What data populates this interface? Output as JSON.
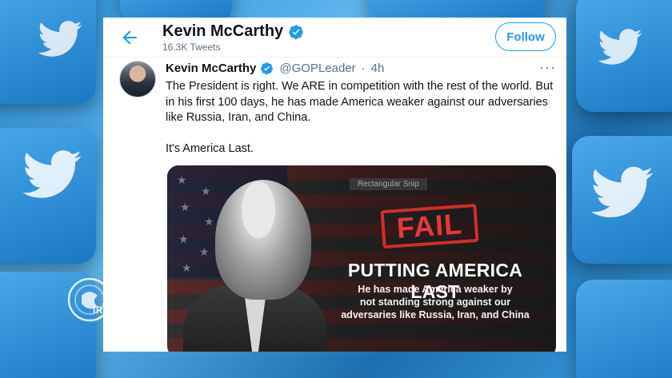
{
  "header": {
    "name": "Kevin McCarthy",
    "tweet_count": "16.3K Tweets",
    "follow_label": "Follow"
  },
  "tweet": {
    "author_name": "Kevin McCarthy",
    "handle": "@GOPLeader",
    "separator": "·",
    "time": "4h",
    "more_label": "···",
    "text": "The President is right. We ARE in competition with the rest of the world. But in his first 100 days, he has made America weaker against our adversaries like Russia, Iran, and China.\n\nIt's America Last."
  },
  "media": {
    "tag": "Rectangular Snip",
    "stamp": "FAIL",
    "headline": "PUTTING AMERICA LAST",
    "subline": "He has made America weaker by\nnot standing strong against our\nadversaries like Russia, Iran, and China"
  },
  "watermark": {
    "text": "IRANPRESS"
  },
  "icons": {
    "back": "arrow-left-icon",
    "verified": "verified-badge-icon",
    "more": "more-options-icon",
    "bird": "twitter-bird-icon"
  },
  "colors": {
    "accent": "#1d9bf0",
    "stamp_red": "#d62b2b",
    "text_primary": "#0f1419",
    "text_secondary": "#5b7083"
  }
}
